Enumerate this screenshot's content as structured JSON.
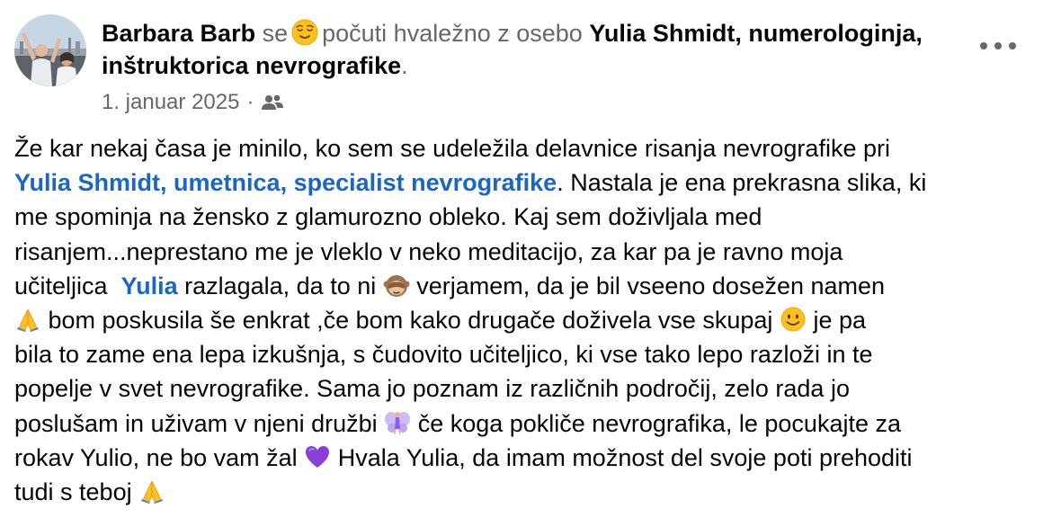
{
  "post": {
    "author": "Barbara Barb",
    "feeling_prefix": "se",
    "feeling_text": "počuti hvaležno z osebo",
    "tagged": "Yulia Shmidt, numerologinja, inštruktorica nevrografike",
    "period": ".",
    "date": "1. januar 2025",
    "separator": "·",
    "audience_icon": "friends-icon",
    "more_icon": "more-horizontal-icon"
  },
  "body": {
    "l1": "Že kar nekaj časa je minilo, ko sem se udeležila delavnice risanja nevrografike pri",
    "l2_mention": "Yulia Shmidt, umetnica, specialist nevrografike",
    "l2_rest": ". Nastala je ena prekrasna slika, ki",
    "l3": "me spominja na žensko z glamurozno obleko. Kaj sem doživljala med",
    "l4": "risanjem...neprestano me je vleklo v neko meditacijo, za kar pa je ravno moja",
    "l5_a": "učiteljica ",
    "l5_mention": "Yulia",
    "l5_b": " razlagala, da to ni ",
    "l5_c": " verjamem, da je bil vseeno dosežen namen",
    "l6_a": " bom poskusila še enkrat ,če bom kako drugače doživela vse skupaj ",
    "l6_b": " je pa",
    "l7": "bila to zame ena lepa izkušnja, s čudovito učiteljico, ki vse tako lepo razloži in te",
    "l8": "popelje v svet nevrografike. Sama jo poznam iz različnih področij, zelo rada jo",
    "l9_a": "poslušam in uživam v njeni družbi ",
    "l9_b": " če koga pokliče nevrografika, le pocukajte za",
    "l10_a": "rokav Yulio, ne bo vam žal ",
    "l10_b": " Hvala Yulia, da imam možnost del svoje poti prehoditi",
    "l11": "tudi s teboj "
  },
  "emojis": {
    "feeling": "relieved-face-emoji",
    "monkey": "see-no-evil-monkey-emoji",
    "pray": "folded-hands-emoji",
    "smile": "smiling-face-emoji",
    "fairy": "fairy-emoji",
    "heart": "purple-heart-emoji"
  },
  "colors": {
    "text": "#050505",
    "muted": "#65676b",
    "link": "#1a66c8"
  }
}
